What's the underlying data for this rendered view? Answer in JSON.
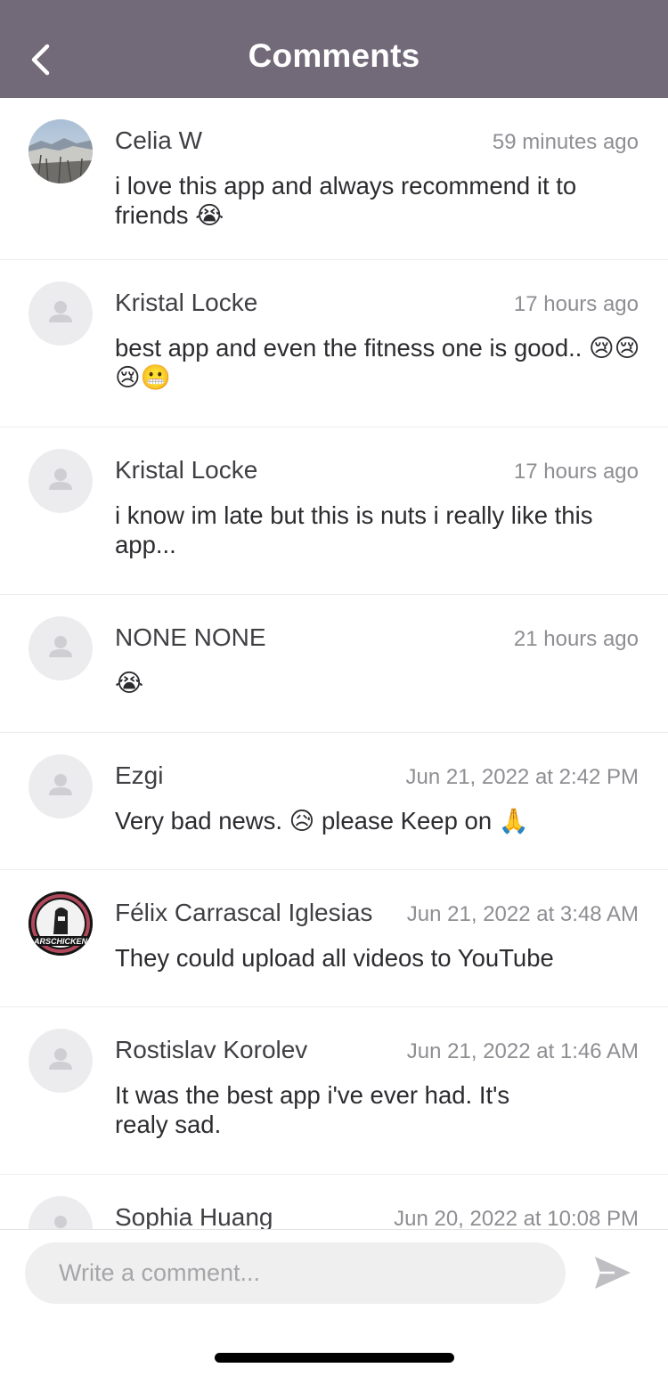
{
  "header": {
    "title": "Comments",
    "back_icon": "chevron-left-icon"
  },
  "comments": [
    {
      "name": "Celia W",
      "time": "59 minutes ago",
      "text": "i love this app and always recommend it to friends 😭",
      "avatar": "photo-landscape"
    },
    {
      "name": "Kristal Locke",
      "time": "17 hours ago",
      "text": "best app and even the fitness one is good.. 😢😢😢😬",
      "avatar": "placeholder"
    },
    {
      "name": "Kristal Locke",
      "time": "17 hours ago",
      "text": "i know im late but this is nuts i really like this app...",
      "avatar": "placeholder"
    },
    {
      "name": "NONE NONE",
      "time": "21 hours ago",
      "text": "😭",
      "avatar": "placeholder"
    },
    {
      "name": "Ezgi",
      "time": "Jun 21, 2022 at 2:42 PM",
      "text": "Very bad news. 😥 please Keep on 🙏",
      "avatar": "placeholder"
    },
    {
      "name": "Félix Carrascal Iglesias",
      "time": "Jun 21, 2022 at 3:48 AM",
      "text": "They could upload all videos to YouTube",
      "avatar": "photo-logo",
      "avatar_logo_text": "ARSCHICKEN"
    },
    {
      "name": "Rostislav Korolev",
      "time": "Jun 21, 2022 at 1:46 AM",
      "text": "It was the best app i've ever had. It's realy sad.",
      "avatar": "placeholder"
    },
    {
      "name": "Sophia Huang",
      "time": "Jun 20, 2022 at 10:08 PM",
      "text": "",
      "avatar": "placeholder"
    }
  ],
  "composer": {
    "placeholder": "Write a comment...",
    "value": "",
    "send_icon": "send-icon"
  },
  "colors": {
    "header_bg": "#726a79",
    "avatar_placeholder_bg": "#ececee",
    "input_bg": "#efefef",
    "send_icon": "#bfbfc3"
  }
}
